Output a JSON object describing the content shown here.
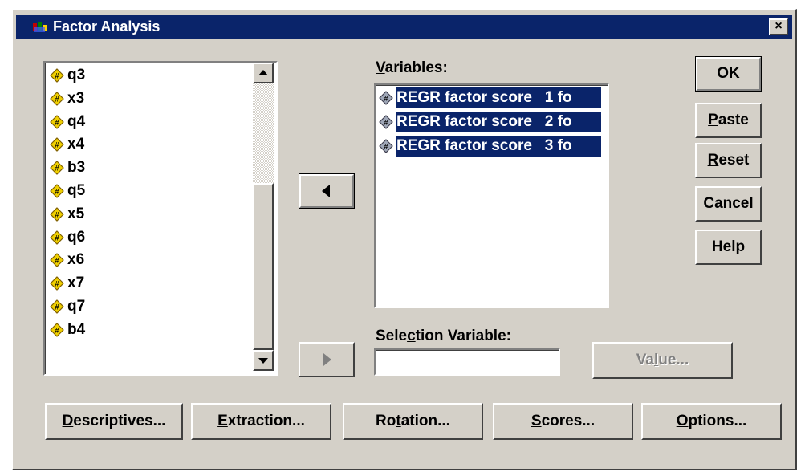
{
  "window": {
    "title": "Factor Analysis",
    "close_label": "×"
  },
  "source_list": {
    "items": [
      "q3",
      "x3",
      "q4",
      "x4",
      "b3",
      "q5",
      "x5",
      "q6",
      "x6",
      "x7",
      "q7",
      "b4"
    ]
  },
  "variables": {
    "label_prefix": "V",
    "label_rest": "ariables:",
    "items": [
      "REGR factor score   1 fo",
      "REGR factor score   2 fo",
      "REGR factor score   3 fo"
    ]
  },
  "selection_variable": {
    "label_pre": "Sele",
    "label_u": "c",
    "label_post": "tion Variable:",
    "value": ""
  },
  "side_buttons": {
    "ok": "OK",
    "paste_u": "P",
    "paste_rest": "aste",
    "reset_u": "R",
    "reset_rest": "eset",
    "cancel": "Cancel",
    "help": "Help"
  },
  "value_button": {
    "pre": "Va",
    "u": "l",
    "post": "ue..."
  },
  "bottom_buttons": {
    "descriptives_u": "D",
    "descriptives_rest": "escriptives...",
    "extraction_u": "E",
    "extraction_rest": "xtraction...",
    "rotation_pre": "Ro",
    "rotation_u": "t",
    "rotation_post": "ation...",
    "scores_u": "S",
    "scores_rest": "cores...",
    "options_u": "O",
    "options_rest": "ptions..."
  },
  "colors": {
    "title_bar": "#0a246a",
    "dialog_bg": "#d4d0c8",
    "selection": "#0a246a",
    "diamond": "#f0d000"
  }
}
